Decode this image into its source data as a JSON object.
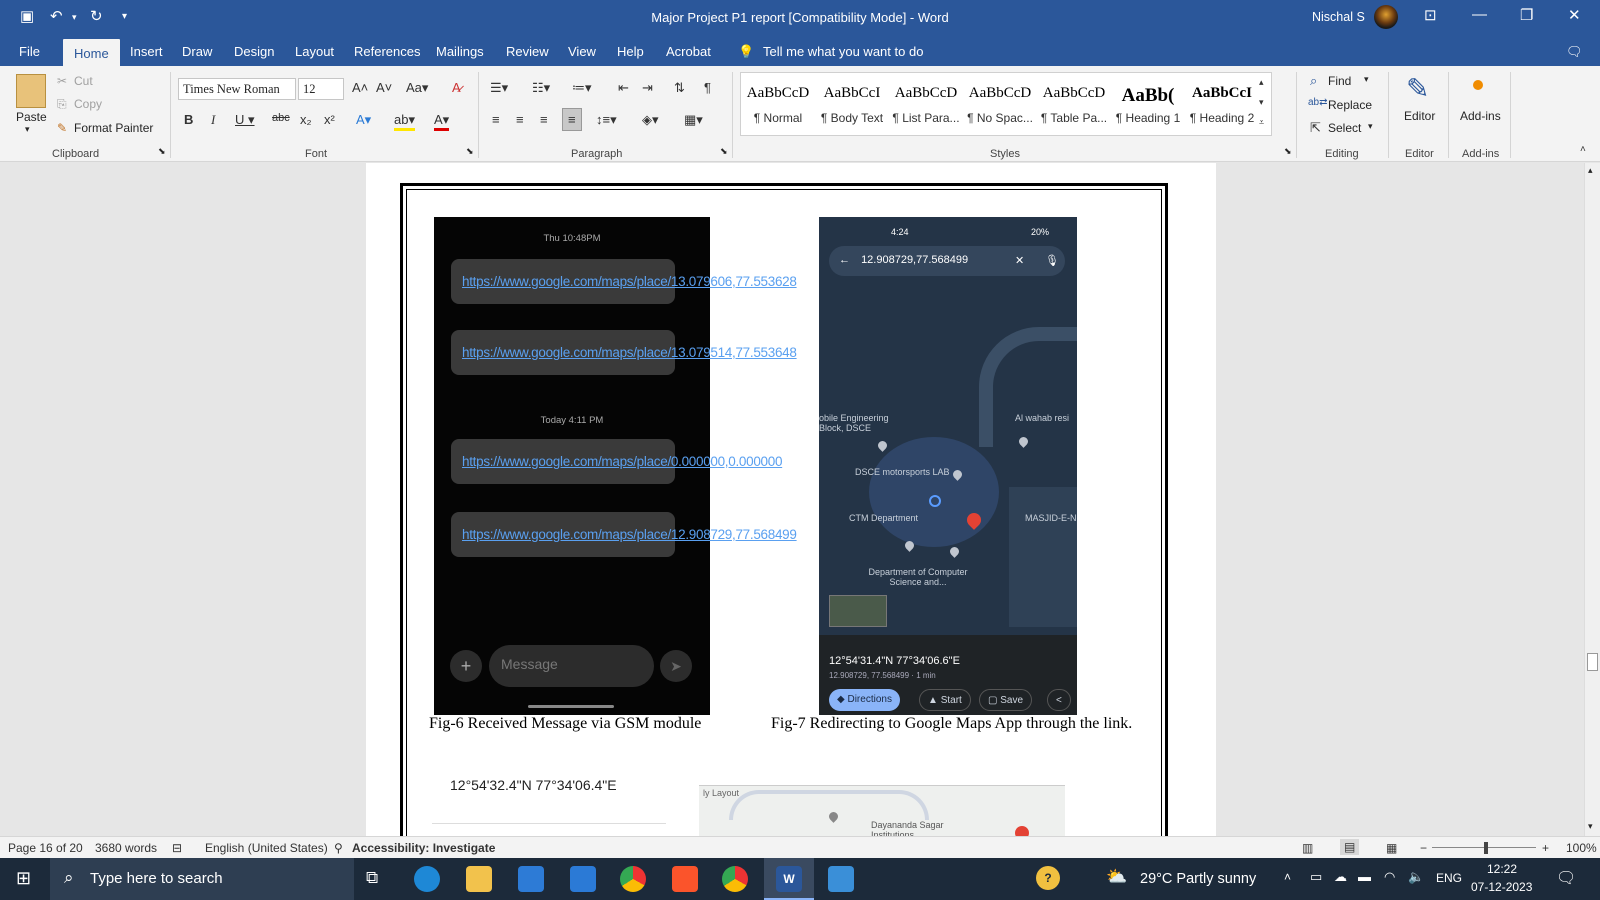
{
  "window": {
    "title": "Major Project P1 report [Compatibility Mode]  -  Word",
    "user": "Nischal S"
  },
  "tabs": [
    "File",
    "Home",
    "Insert",
    "Draw",
    "Design",
    "Layout",
    "References",
    "Mailings",
    "Review",
    "View",
    "Help",
    "Acrobat"
  ],
  "tell_me": "Tell me what you want to do",
  "clipboard": {
    "paste": "Paste",
    "cut": "Cut",
    "copy": "Copy",
    "format_painter": "Format Painter",
    "label": "Clipboard"
  },
  "font": {
    "name": "Times New Roman",
    "size": "12",
    "label": "Font"
  },
  "paragraph": {
    "label": "Paragraph"
  },
  "styles": {
    "label": "Styles",
    "items": [
      {
        "sample": "AaBbCcD",
        "name": "¶ Normal"
      },
      {
        "sample": "AaBbCcI",
        "name": "¶ Body Text"
      },
      {
        "sample": "AaBbCcD",
        "name": "¶ List Para..."
      },
      {
        "sample": "AaBbCcD",
        "name": "¶ No Spac..."
      },
      {
        "sample": "AaBbCcD",
        "name": "¶ Table Pa..."
      },
      {
        "sample": "AaBb(",
        "name": "¶ Heading 1"
      },
      {
        "sample": "AaBbCcI",
        "name": "¶ Heading 2"
      }
    ]
  },
  "editing": {
    "find": "Find",
    "replace": "Replace",
    "select": "Select",
    "label": "Editing"
  },
  "editor": {
    "label": "Editor",
    "button": "Editor"
  },
  "addins": {
    "label": "Add-ins",
    "button": "Add-ins"
  },
  "doc": {
    "phone1": {
      "day1": "Thu 10:48PM",
      "msgs": [
        "https://www.google.com/maps/place/13.079606,77.553628",
        "https://www.google.com/maps/place/13.079514,77.553648",
        "https://www.google.com/maps/place/0.000000,0.000000",
        "https://www.google.com/maps/place/12.908729,77.568499"
      ],
      "day2": "Today 4:11 PM",
      "placeholder": "Message"
    },
    "phone2": {
      "time": "4:24",
      "battery": "20%",
      "search": "12.908729,77.568499",
      "labels": [
        "obile Engineering Block, DSCE",
        "Al wahab resi",
        "DSCE motorsports LAB",
        "CTM Department",
        "MASJID-E-N",
        "Department of Computer Science and..."
      ],
      "coords_dms": "12°54'31.4\"N 77°34'06.6\"E",
      "coords_dec": "12.908729, 77.568499 · 1 min",
      "buttons": [
        "Directions",
        "Start",
        "Save"
      ]
    },
    "caption1": "Fig-6 Received Message via GSM module",
    "caption2": "Fig-7 Redirecting to Google Maps App through the link.",
    "bottom_coords": "12°54'32.4\"N 77°34'06.4\"E",
    "bottom_map_label": "Dayananda Sagar Institutions",
    "bottom_map_layout": "ly Layout"
  },
  "status": {
    "page": "Page 16 of 20",
    "words": "3680 words",
    "language": "English (United States)",
    "accessibility": "Accessibility: Investigate",
    "zoom": "100%"
  },
  "taskbar": {
    "search": "Type here to search",
    "weather": "29°C  Partly sunny",
    "lang": "ENG",
    "time": "12:22",
    "date": "07-12-2023"
  }
}
